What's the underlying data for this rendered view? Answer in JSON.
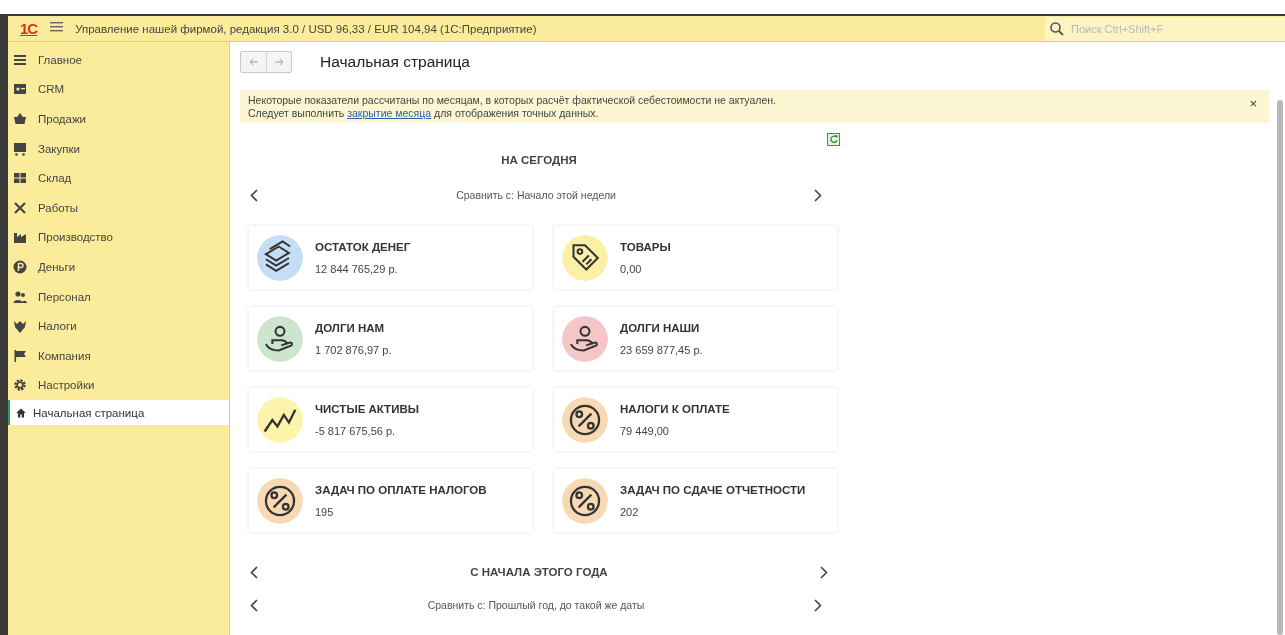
{
  "window": {
    "logo": "1С",
    "title": "Управление нашей фирмой, редакция 3.0 / USD 96,33 / EUR 104,94  (1С:Предприятие)"
  },
  "search": {
    "placeholder": "Поиск Ctrl+Shift+F"
  },
  "sidebar": {
    "items": [
      {
        "label": "Главное"
      },
      {
        "label": "CRM"
      },
      {
        "label": "Продажи"
      },
      {
        "label": "Закупки"
      },
      {
        "label": "Склад"
      },
      {
        "label": "Работы"
      },
      {
        "label": "Производство"
      },
      {
        "label": "Деньги"
      },
      {
        "label": "Персонал"
      },
      {
        "label": "Налоги"
      },
      {
        "label": "Компания"
      },
      {
        "label": "Настройки"
      }
    ],
    "open_pages": [
      {
        "label": "Начальная страница",
        "selected": true
      }
    ]
  },
  "page": {
    "title": "Начальная страница"
  },
  "notice": {
    "text_before": "Некоторые показатели рассчитаны по месяцам, в которых расчёт фактической себестоимости не актуален.",
    "text_line2_start": "Следует выполнить",
    "link": "закрытие месяца",
    "text_line2_end": "для отображения точных данных.",
    "close": "×"
  },
  "sections": [
    {
      "kind": "static",
      "title": "НА СЕГОДНЯ",
      "compare": "Сравнить с: Начало этой недели",
      "cards": [
        {
          "kind": "money",
          "color": "#c5ddf5",
          "title": "ОСТАТОК ДЕНЕГ",
          "value": "12 844 765,29 р."
        },
        {
          "kind": "tag",
          "color": "#fbf0a6",
          "title": "ТОВАРЫ",
          "value": "0,00"
        },
        {
          "kind": "hand",
          "color": "#cde5cc",
          "title": "ДОЛГИ НАМ",
          "value": "1 702 876,97 р."
        },
        {
          "kind": "hand",
          "color": "#f5c6c6",
          "title": "ДОЛГИ НАШИ",
          "value": "23 659 877,45 р."
        },
        {
          "kind": "chart",
          "color": "#fbf4aa",
          "title": "ЧИСТЫЕ АКТИВЫ",
          "value": "-5 817 675,56 р."
        },
        {
          "kind": "percent",
          "color": "#f9d9b3",
          "title": "НАЛОГИ К ОПЛАТЕ",
          "value": "79 449,00"
        },
        {
          "kind": "percent",
          "color": "#f9d9b3",
          "title": "ЗАДАЧ ПО ОПЛАТЕ НАЛОГОВ",
          "value": "195"
        },
        {
          "kind": "percent",
          "color": "#f9d9b3",
          "title": "ЗАДАЧ ПО СДАЧЕ ОТЧЕТНОСТИ",
          "value": "202"
        }
      ]
    },
    {
      "kind": "switchable",
      "title": "С НАЧАЛА ЭТОГО ГОДА",
      "compare": "Сравнить с: Прошлый год, до такой же даты"
    }
  ]
}
